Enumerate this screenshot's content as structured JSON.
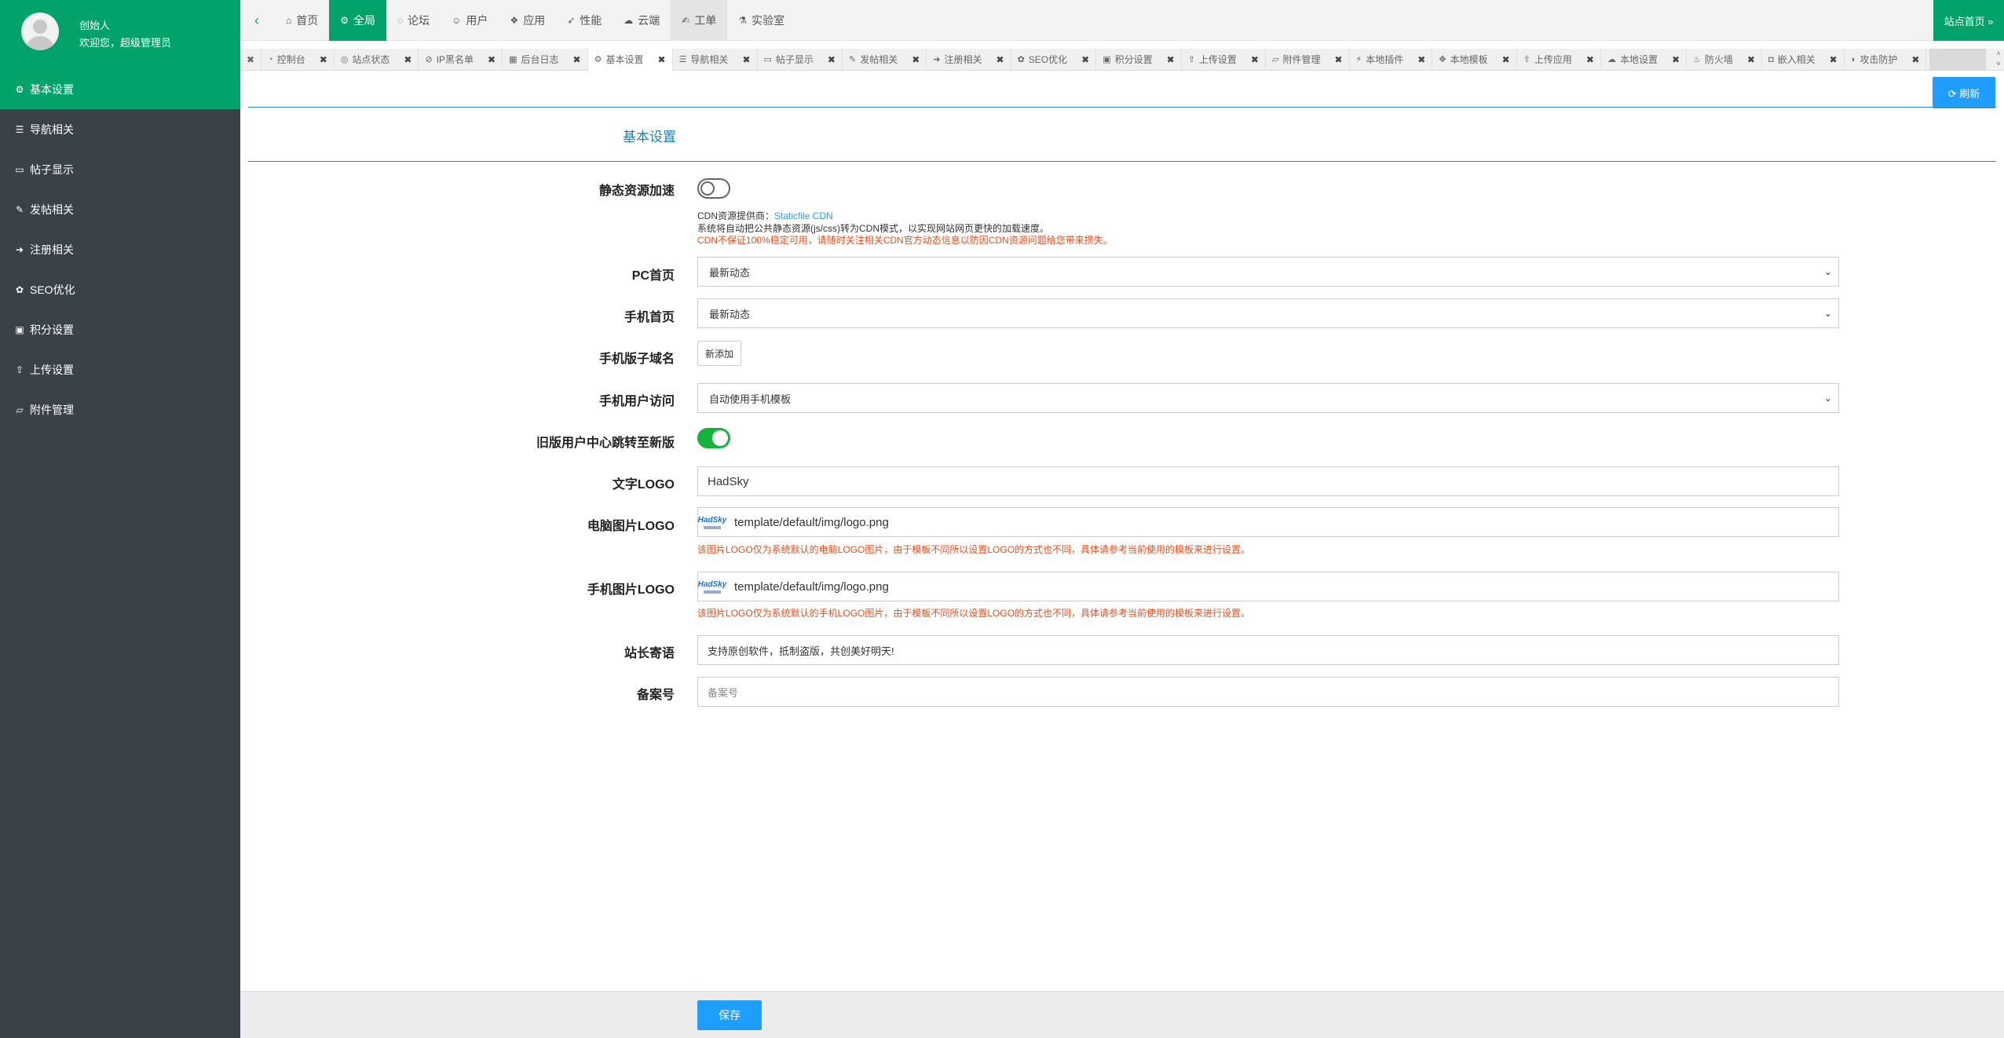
{
  "profile": {
    "name": "创始人",
    "welcome": "欢迎您，超级管理员"
  },
  "sidebar": {
    "items": [
      {
        "label": "基本设置",
        "icon": "gear-icon",
        "glyph": "⚙"
      },
      {
        "label": "导航相关",
        "icon": "list-icon",
        "glyph": "☰"
      },
      {
        "label": "帖子显示",
        "icon": "monitor-icon",
        "glyph": "▭"
      },
      {
        "label": "发帖相关",
        "icon": "edit-icon",
        "glyph": "✎"
      },
      {
        "label": "注册相关",
        "icon": "sign-in-icon",
        "glyph": "➜"
      },
      {
        "label": "SEO优化",
        "icon": "paw-icon",
        "glyph": "✿"
      },
      {
        "label": "积分设置",
        "icon": "money-icon",
        "glyph": "▣"
      },
      {
        "label": "上传设置",
        "icon": "upload-icon",
        "glyph": "⇪"
      },
      {
        "label": "附件管理",
        "icon": "folder-icon",
        "glyph": "▱"
      }
    ]
  },
  "topnav": {
    "items": [
      {
        "label": "首页",
        "icon": "home-icon",
        "glyph": "⌂"
      },
      {
        "label": "全局",
        "icon": "cogs-icon",
        "glyph": "⚙"
      },
      {
        "label": "论坛",
        "icon": "comments-icon",
        "glyph": "◌"
      },
      {
        "label": "用户",
        "icon": "users-icon",
        "glyph": "☺"
      },
      {
        "label": "应用",
        "icon": "cubes-icon",
        "glyph": "❖"
      },
      {
        "label": "性能",
        "icon": "rocket-icon",
        "glyph": "➶"
      },
      {
        "label": "云端",
        "icon": "cloud-icon",
        "glyph": "☁"
      },
      {
        "label": "工单",
        "icon": "wrench-icon",
        "glyph": "✍"
      },
      {
        "label": "实验室",
        "icon": "flask-icon",
        "glyph": "⚗"
      }
    ],
    "site_home": "站点首页 »",
    "collapse": "‹"
  },
  "tabs": {
    "items": [
      {
        "label": "控制台",
        "icon": "dashboard-icon",
        "glyph": "◔"
      },
      {
        "label": "站点状态",
        "icon": "status-icon",
        "glyph": "◎"
      },
      {
        "label": "IP黑名单",
        "icon": "ban-icon",
        "glyph": "⊘"
      },
      {
        "label": "后台日志",
        "icon": "calendar-icon",
        "glyph": "▦"
      },
      {
        "label": "基本设置",
        "icon": "gear-icon",
        "glyph": "⚙"
      },
      {
        "label": "导航相关",
        "icon": "list-icon",
        "glyph": "☰"
      },
      {
        "label": "帖子显示",
        "icon": "monitor-icon",
        "glyph": "▭"
      },
      {
        "label": "发帖相关",
        "icon": "edit-icon",
        "glyph": "✎"
      },
      {
        "label": "注册相关",
        "icon": "sign-in-icon",
        "glyph": "➜"
      },
      {
        "label": "SEO优化",
        "icon": "paw-icon",
        "glyph": "✿"
      },
      {
        "label": "积分设置",
        "icon": "money-icon",
        "glyph": "▣"
      },
      {
        "label": "上传设置",
        "icon": "upload-icon",
        "glyph": "⇪"
      },
      {
        "label": "附件管理",
        "icon": "folder-icon",
        "glyph": "▱"
      },
      {
        "label": "本地插件",
        "icon": "plug-icon",
        "glyph": "⚡"
      },
      {
        "label": "本地模板",
        "icon": "puzzle-icon",
        "glyph": "✥"
      },
      {
        "label": "上传应用",
        "icon": "upload-icon",
        "glyph": "⇪"
      },
      {
        "label": "本地设置",
        "icon": "cloud-icon",
        "glyph": "☁"
      },
      {
        "label": "防火墙",
        "icon": "fire-icon",
        "glyph": "♨"
      },
      {
        "label": "嵌入相关",
        "icon": "car-icon",
        "glyph": "◘"
      },
      {
        "label": "攻击防护",
        "icon": "shield-icon",
        "glyph": "◗"
      }
    ],
    "close": "✖",
    "active_index": 4
  },
  "buttons": {
    "refresh": "⟳ 刷新",
    "save": "保存",
    "add": "新添加"
  },
  "section_title": "基本设置",
  "form": {
    "cdn_label": "静态资源加速",
    "cdn_enabled": false,
    "cdn_provider_prefix": "CDN资源提供商：",
    "cdn_provider_link": "Staticfile CDN",
    "cdn_desc": "系统将自动把公共静态资源(js/css)转为CDN模式，以实现网站网页更快的加载速度。",
    "cdn_warning": "CDN不保证100%稳定可用，请随时关注相关CDN官方动态信息以防因CDN资源问题给您带来损失。",
    "pc_home_label": "PC首页",
    "pc_home_value": "最新动态",
    "mobile_home_label": "手机首页",
    "mobile_home_value": "最新动态",
    "mobile_domain_label": "手机版子域名",
    "mobile_access_label": "手机用户访问",
    "mobile_access_value": "自动使用手机模板",
    "old_center_label": "旧版用户中心跳转至新版",
    "old_center_enabled": true,
    "text_logo_label": "文字LOGO",
    "text_logo_value": "HadSky",
    "pc_logo_label": "电脑图片LOGO",
    "pc_logo_value": "template/default/img/logo.png",
    "pc_logo_help": "该图片LOGO仅为系统默认的电脑LOGO图片，由于模板不同所以设置LOGO的方式也不同，具体请参考当前使用的模板来进行设置。",
    "mobile_logo_label": "手机图片LOGO",
    "mobile_logo_value": "template/default/img/logo.png",
    "mobile_logo_help": "该图片LOGO仅为系统默认的手机LOGO图片，由于模板不同所以设置LOGO的方式也不同，具体请参考当前使用的模板来进行设置。",
    "logo_thumb_text": "HadSky",
    "motto_label": "站长寄语",
    "motto_value": "支持原创软件，抵制盗版，共创美好明天!",
    "icp_label": "备案号",
    "icp_placeholder": "备案号"
  },
  "colors": {
    "brand": "#01a36b",
    "sidebar": "#3a4149",
    "primary_button": "#1e9fff",
    "toggle_on": "#16b23e",
    "warning_text": "#e5501c"
  }
}
